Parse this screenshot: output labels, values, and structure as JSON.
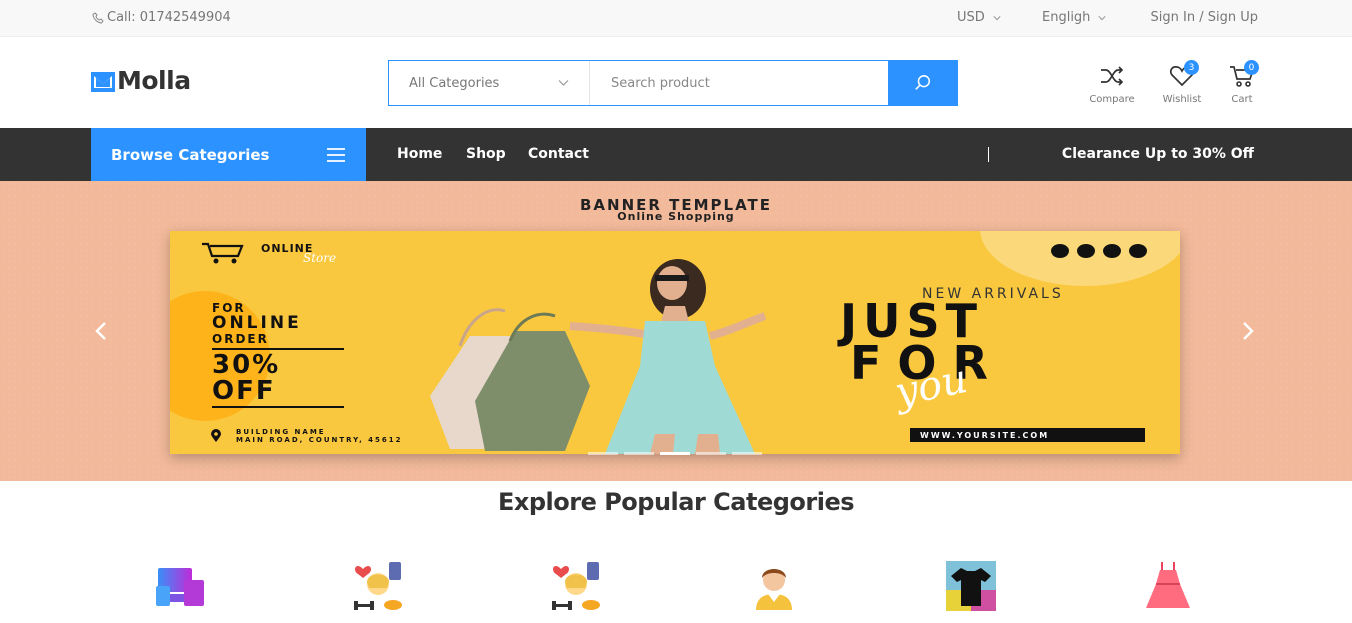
{
  "topbar": {
    "call": "Call: 01742549904",
    "currency": "USD",
    "language": "Engligh",
    "signin": "Sign In / Sign Up"
  },
  "header": {
    "logo": "Molla",
    "search": {
      "category": "All Categories",
      "placeholder": "Search product"
    },
    "icons": [
      {
        "name": "shuffle-icon",
        "label": "Compare"
      },
      {
        "name": "heart-icon",
        "label": "Wishlist",
        "badge": "3"
      },
      {
        "name": "cart-icon",
        "label": "Cart",
        "badge": "0"
      }
    ]
  },
  "nav": {
    "browse": "Browse Categories",
    "links": [
      "Home",
      "Shop",
      "Contact"
    ],
    "clearance": "Clearance Up to 30% Off"
  },
  "banner": {
    "title": "BANNER TEMPLATE",
    "subtitle": "Online Shopping",
    "online": "ONLINE",
    "store": "Store",
    "promo": {
      "line1": "FOR",
      "line2": "ONLINE",
      "line3": "ORDER",
      "percent": "30%",
      "off": "OFF"
    },
    "address": [
      "BUILDING NAME",
      "MAIN ROAD, COUNTRY, 45612"
    ],
    "new_arrivals": "NEW ARRIVALS",
    "just": "JUST",
    "for": "FOR",
    "you": "you",
    "website": "WWW.YOURSITE.COM",
    "slides": 5,
    "active_slide": 3
  },
  "categories": {
    "title": "Explore Popular Categories",
    "icons": [
      "electronics-icon",
      "fitness-icon",
      "fitness-icon",
      "men-icon",
      "tshirt-icon",
      "dress-icon"
    ]
  },
  "colors": {
    "accent": "#2c92ff",
    "navbar": "#333333",
    "banner_bg": "#f2b99a",
    "card": "#f9c83f"
  }
}
